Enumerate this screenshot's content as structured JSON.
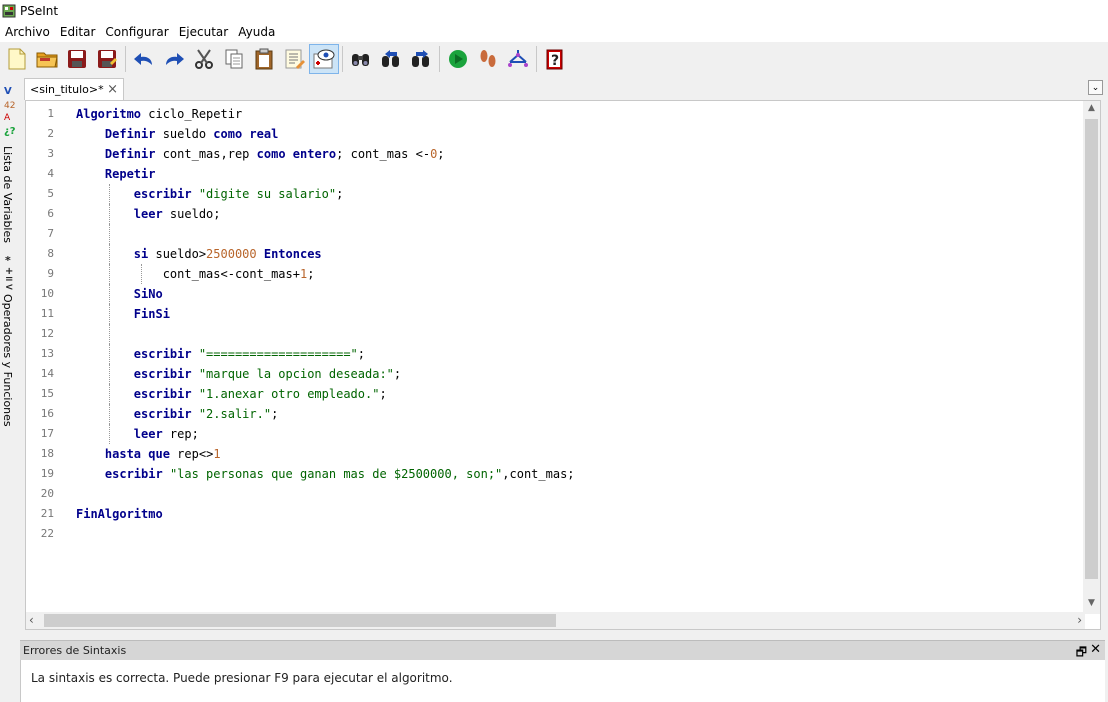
{
  "window": {
    "title": "PSeInt"
  },
  "menu": [
    "Archivo",
    "Editar",
    "Configurar",
    "Ejecutar",
    "Ayuda"
  ],
  "toolbar": [
    "new-file-icon",
    "open-folder-icon",
    "save-icon",
    "save-as-icon",
    "undo-icon",
    "redo-icon",
    "cut-icon",
    "copy-icon",
    "paste-icon",
    "edit-doc-icon",
    "explore-vars-icon",
    "find-icon",
    "find-prev-icon",
    "find-next-icon",
    "run-icon",
    "step-icon",
    "flowchart-icon",
    "help-icon"
  ],
  "side": {
    "variables_label": "Lista de Variables",
    "operators_label": "Operadores y Funciones"
  },
  "tab": {
    "label": "<sin_titulo>*",
    "close": "×"
  },
  "editor": {
    "line_numbers": [
      "1",
      "2",
      "3",
      "4",
      "5",
      "6",
      "7",
      "8",
      "9",
      "10",
      "11",
      "12",
      "13",
      "14",
      "15",
      "16",
      "17",
      "18",
      "19",
      "20",
      "21",
      "22"
    ]
  },
  "errors_panel": {
    "title": "Errores de Sintaxis",
    "message": "La sintaxis es correcta. Puede presionar F9 para ejecutar el algoritmo."
  },
  "colors": {
    "keyword": "#00008b",
    "string": "#006400",
    "number": "#b8652b"
  }
}
